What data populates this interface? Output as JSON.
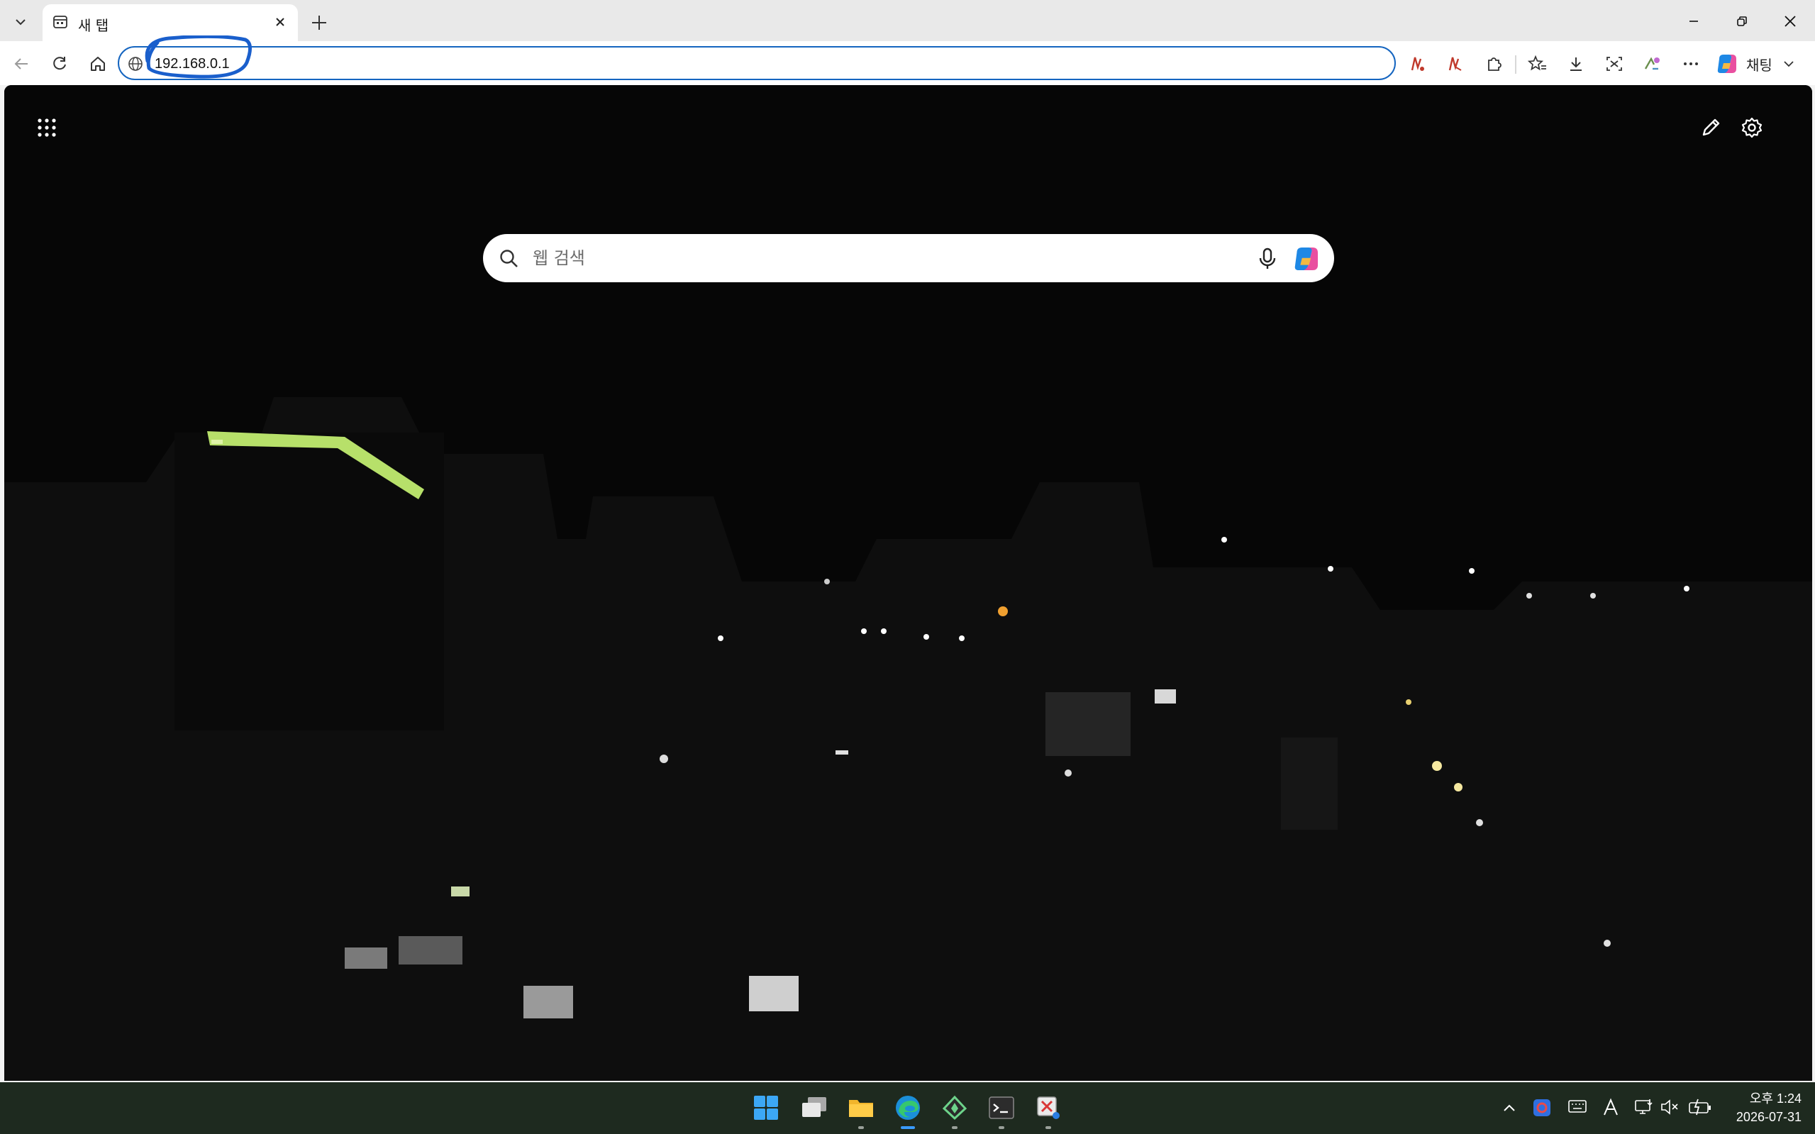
{
  "browser": {
    "tab": {
      "title": "새 탭"
    },
    "address_bar": {
      "url": "192.168.0.1"
    },
    "copilot": {
      "label": "채팅"
    }
  },
  "newtab": {
    "search": {
      "placeholder": "웹 검색"
    }
  },
  "taskbar": {
    "clock": {
      "time": "오후 1:24",
      "date": "2026-07-31"
    },
    "pinned_apps": [
      "start-icon",
      "task-view-icon",
      "file-explorer-icon",
      "edge-icon",
      "app-icon",
      "terminal-icon",
      "snipping-tool-icon"
    ],
    "tray_icons": [
      "show-hidden-icons",
      "app-tray-icon",
      "keyboard-icon",
      "ime-icon",
      "network-icon",
      "volume-muted-icon",
      "battery-icon"
    ]
  },
  "colors": {
    "accent": "#1565c0",
    "annotation": "#1a5fcc",
    "taskbar": "#1e2a1f"
  }
}
